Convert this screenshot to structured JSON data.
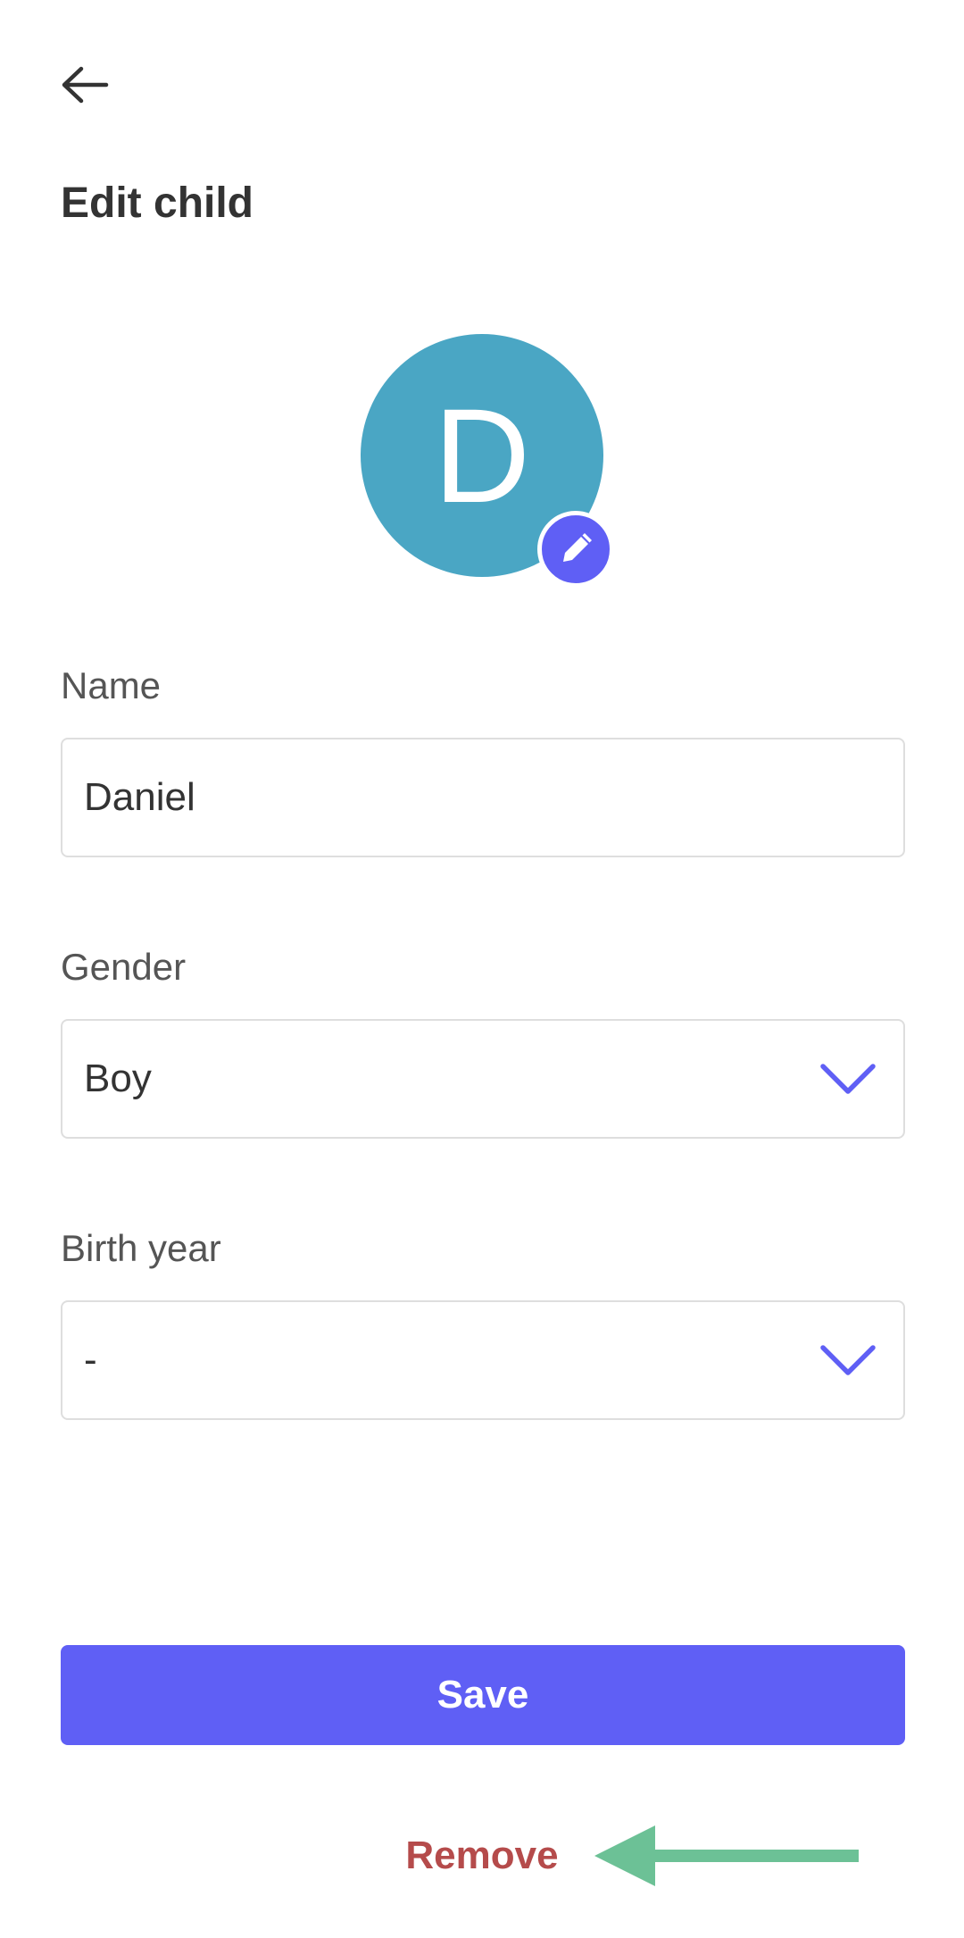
{
  "colors": {
    "accent": "#5f5ff5",
    "avatar_bg": "#4aa6c4",
    "remove": "#b54b4b",
    "annotation_arrow": "#6cc196"
  },
  "header": {
    "back_icon": "arrow-left-icon",
    "title": "Edit child"
  },
  "avatar": {
    "initial": "D",
    "edit_icon": "pencil-icon"
  },
  "form": {
    "name": {
      "label": "Name",
      "value": "Daniel"
    },
    "gender": {
      "label": "Gender",
      "value": "Boy",
      "icon": "chevron-down-icon"
    },
    "birth_year": {
      "label": "Birth year",
      "value": "-",
      "icon": "chevron-down-icon"
    }
  },
  "actions": {
    "save_label": "Save",
    "remove_label": "Remove"
  },
  "annotation": {
    "icon": "arrow-left-icon"
  }
}
